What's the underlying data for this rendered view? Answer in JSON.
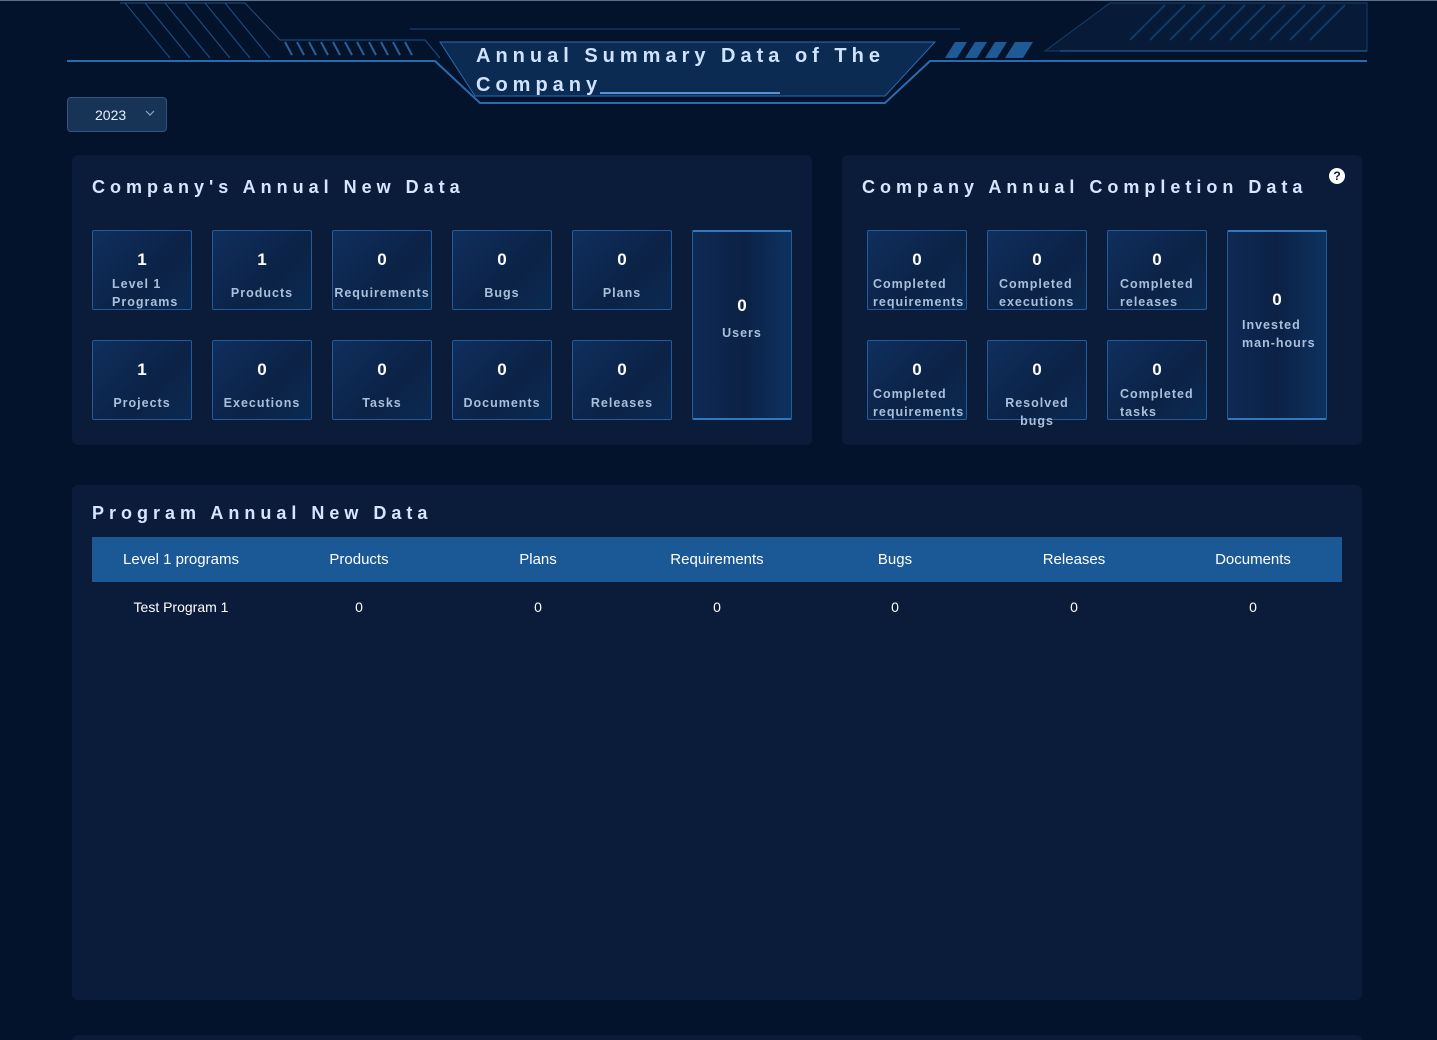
{
  "header": {
    "title": "Annual Summary Data of The Company"
  },
  "year_select": {
    "value": "2023"
  },
  "new_data": {
    "title": "Company's Annual New Data",
    "cards": [
      {
        "value": "1",
        "label": "Level 1 Programs"
      },
      {
        "value": "1",
        "label": "Products"
      },
      {
        "value": "0",
        "label": "Requirements"
      },
      {
        "value": "0",
        "label": "Bugs"
      },
      {
        "value": "0",
        "label": "Plans"
      },
      {
        "value": "1",
        "label": "Projects"
      },
      {
        "value": "0",
        "label": "Executions"
      },
      {
        "value": "0",
        "label": "Tasks"
      },
      {
        "value": "0",
        "label": "Documents"
      },
      {
        "value": "0",
        "label": "Releases"
      }
    ],
    "users": {
      "value": "0",
      "label": "Users"
    }
  },
  "completion_data": {
    "title": "Company Annual Completion Data",
    "help": "?",
    "cards": [
      {
        "value": "0",
        "label": "Completed requirements"
      },
      {
        "value": "0",
        "label": "Completed executions"
      },
      {
        "value": "0",
        "label": "Completed releases"
      },
      {
        "value": "0",
        "label": "Completed requirements"
      },
      {
        "value": "0",
        "label": "Resolved bugs"
      },
      {
        "value": "0",
        "label": "Completed tasks"
      }
    ],
    "hours": {
      "value": "0",
      "label": "Invested man-hours"
    }
  },
  "program_data": {
    "title": "Program Annual New Data",
    "columns": [
      "Level 1 programs",
      "Products",
      "Plans",
      "Requirements",
      "Bugs",
      "Releases",
      "Documents"
    ],
    "rows": [
      [
        "Test Program 1",
        "0",
        "0",
        "0",
        "0",
        "0",
        "0"
      ]
    ]
  },
  "colors": {
    "background": "#04132c",
    "panel": "#0b1c3a",
    "table_header": "#1a5896",
    "accent": "#2f79c2"
  }
}
